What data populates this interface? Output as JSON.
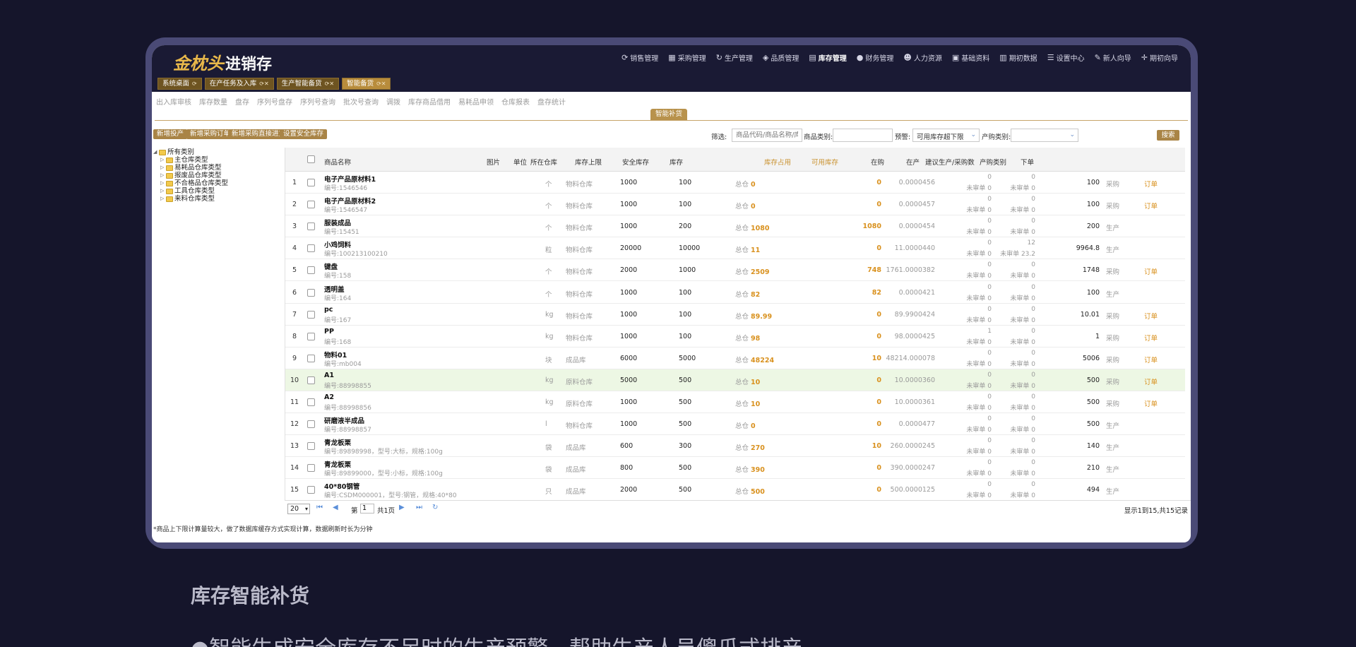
{
  "app": {
    "logo_gold": "金枕头",
    "logo_white": "进销存",
    "nav": [
      {
        "label": "销售管理",
        "icon": "refresh-icon",
        "glyph": "⟳"
      },
      {
        "label": "采购管理",
        "icon": "document-icon",
        "glyph": "▦"
      },
      {
        "label": "生产管理",
        "icon": "cycle-icon",
        "glyph": "↻"
      },
      {
        "label": "品质管理",
        "icon": "diamond-icon",
        "glyph": "◈"
      },
      {
        "label": "库存管理",
        "icon": "grid-icon",
        "glyph": "▤"
      },
      {
        "label": "财务管理",
        "icon": "coin-icon",
        "glyph": "●"
      },
      {
        "label": "人力资源",
        "icon": "people-icon",
        "glyph": "☻"
      },
      {
        "label": "基础资料",
        "icon": "list-icon",
        "glyph": "▣"
      },
      {
        "label": "期初数据",
        "icon": "table-icon",
        "glyph": "▥"
      },
      {
        "label": "设置中心",
        "icon": "sliders-icon",
        "glyph": "☰"
      },
      {
        "label": "新人向导",
        "icon": "guide-icon",
        "glyph": "✎"
      },
      {
        "label": "期初向导",
        "icon": "move-icon",
        "glyph": "✛"
      }
    ],
    "tabs": [
      "系统桌面",
      "在产任务及入库",
      "生产智能备货",
      "智能备货"
    ]
  },
  "subnav": [
    "出入库审核",
    "库存数量",
    "盘存",
    "序列号盘存",
    "序列号查询",
    "批次号查询",
    "调拨",
    "库存商品借用",
    "易耗品申领",
    "仓库报表",
    "盘存统计"
  ],
  "module_tab": "智能补货",
  "actions": [
    "新增投产",
    "新增采购订单",
    "新增采购直接进货",
    "设置安全库存"
  ],
  "filters": {
    "label": "筛选:",
    "search_placeholder": "商品代码/商品名称/库位",
    "category_label": "商品类别:",
    "category_value": "",
    "warning_label": "预警:",
    "warning_value": "可用库存超下限",
    "type_label": "产购类别:",
    "type_value": "",
    "search_button": "搜索"
  },
  "tree": {
    "root": "所有类别",
    "children": [
      "主仓库类型",
      "易耗品仓库类型",
      "报废品仓库类型",
      "不合格品仓库类型",
      "工具仓库类型",
      "来料仓库类型"
    ]
  },
  "table": {
    "headers": {
      "name": "商品名称",
      "image": "图片",
      "unit": "单位",
      "warehouse": "所在仓库",
      "max": "库存上限",
      "safe": "安全库存",
      "stock": "库存",
      "occupied": "库存占用",
      "available": "可用库存",
      "purchasing": "在购",
      "producing": "在产",
      "suggest": "建议生产/采购数",
      "type": "产购类别",
      "order": "下单"
    },
    "rows": [
      {
        "idx": "1",
        "name": "电子产品原材料1",
        "code": "编号:1546546",
        "unit": "个",
        "wh": "物料仓库",
        "max": "1000",
        "safe": "100",
        "stock_pre": "总仓",
        "stock": "0",
        "occ": "0",
        "avail": "0.0000456",
        "po1": "0",
        "po2": "未审单 0",
        "pr1": "0",
        "pr2": "未审单 0",
        "sug": "100",
        "type": "采购",
        "order": "订单"
      },
      {
        "idx": "2",
        "name": "电子产品原材料2",
        "code": "编号:1546547",
        "unit": "个",
        "wh": "物料仓库",
        "max": "1000",
        "safe": "100",
        "stock_pre": "总仓",
        "stock": "0",
        "occ": "0",
        "avail": "0.0000457",
        "po1": "0",
        "po2": "未审单 0",
        "pr1": "0",
        "pr2": "未审单 0",
        "sug": "100",
        "type": "采购",
        "order": "订单"
      },
      {
        "idx": "3",
        "name": "服装成品",
        "code": "编号:15451",
        "unit": "个",
        "wh": "物料仓库",
        "max": "1000",
        "safe": "200",
        "stock_pre": "总仓",
        "stock": "1080",
        "occ": "1080",
        "avail": "0.0000454",
        "po1": "0",
        "po2": "未审单 0",
        "pr1": "0",
        "pr2": "未审单 0",
        "sug": "200",
        "type": "生产",
        "order": ""
      },
      {
        "idx": "4",
        "name": "小鸡饲料",
        "code": "编号:100213100210",
        "unit": "粒",
        "wh": "物料仓库",
        "max": "20000",
        "safe": "10000",
        "stock_pre": "总仓",
        "stock": "11",
        "occ": "0",
        "avail": "11.0000440",
        "po1": "0",
        "po2": "未审单 0",
        "pr1": "12",
        "pr2": "未审单 23.2",
        "sug": "9964.8",
        "type": "生产",
        "order": ""
      },
      {
        "idx": "5",
        "name": "键盘",
        "code": "编号:158",
        "unit": "个",
        "wh": "物料仓库",
        "max": "2000",
        "safe": "1000",
        "stock_pre": "总仓",
        "stock": "2509",
        "occ": "748",
        "avail": "1761.0000382",
        "po1": "0",
        "po2": "未审单 0",
        "pr1": "0",
        "pr2": "未审单 0",
        "sug": "1748",
        "type": "采购",
        "order": "订单"
      },
      {
        "idx": "6",
        "name": "透明盖",
        "code": "编号:164",
        "unit": "个",
        "wh": "物料仓库",
        "max": "1000",
        "safe": "100",
        "stock_pre": "总仓",
        "stock": "82",
        "occ": "82",
        "avail": "0.0000421",
        "po1": "0",
        "po2": "未审单 0",
        "pr1": "0",
        "pr2": "未审单 0",
        "sug": "100",
        "type": "生产",
        "order": ""
      },
      {
        "idx": "7",
        "name": "pc",
        "code": "编号:167",
        "unit": "kg",
        "wh": "物料仓库",
        "max": "1000",
        "safe": "100",
        "stock_pre": "总仓",
        "stock": "89.99",
        "occ": "0",
        "avail": "89.9900424",
        "po1": "0",
        "po2": "未审单 0",
        "pr1": "0",
        "pr2": "未审单 0",
        "sug": "10.01",
        "type": "采购",
        "order": "订单"
      },
      {
        "idx": "8",
        "name": "PP",
        "code": "编号:168",
        "unit": "kg",
        "wh": "物料仓库",
        "max": "1000",
        "safe": "100",
        "stock_pre": "总仓",
        "stock": "98",
        "occ": "0",
        "avail": "98.0000425",
        "po1": "1",
        "po2": "未审单 0",
        "pr1": "0",
        "pr2": "未审单 0",
        "sug": "1",
        "type": "采购",
        "order": "订单"
      },
      {
        "idx": "9",
        "name": "物料01",
        "code": "编号:mb004",
        "unit": "块",
        "wh": "成品库",
        "max": "6000",
        "safe": "5000",
        "stock_pre": "总仓",
        "stock": "48224",
        "occ": "10",
        "avail": "48214.000078",
        "po1": "0",
        "po2": "未审单 0",
        "pr1": "0",
        "pr2": "未审单 0",
        "sug": "5006",
        "type": "采购",
        "order": "订单"
      },
      {
        "idx": "10",
        "name": "A1",
        "code": "编号:88998855",
        "unit": "kg",
        "wh": "原料仓库",
        "max": "5000",
        "safe": "500",
        "stock_pre": "总仓",
        "stock": "10",
        "occ": "0",
        "avail": "10.0000360",
        "po1": "0",
        "po2": "未审单 0",
        "pr1": "0",
        "pr2": "未审单 0",
        "sug": "500",
        "type": "采购",
        "order": "订单"
      },
      {
        "idx": "11",
        "name": "A2",
        "code": "编号:88998856",
        "unit": "kg",
        "wh": "原料仓库",
        "max": "1000",
        "safe": "500",
        "stock_pre": "总仓",
        "stock": "10",
        "occ": "0",
        "avail": "10.0000361",
        "po1": "0",
        "po2": "未审单 0",
        "pr1": "0",
        "pr2": "未审单 0",
        "sug": "500",
        "type": "采购",
        "order": "订单"
      },
      {
        "idx": "12",
        "name": "研磨液半成品",
        "code": "编号:88998857",
        "unit": "l",
        "wh": "物料仓库",
        "max": "1000",
        "safe": "500",
        "stock_pre": "总仓",
        "stock": "0",
        "occ": "0",
        "avail": "0.0000477",
        "po1": "0",
        "po2": "未审单 0",
        "pr1": "0",
        "pr2": "未审单 0",
        "sug": "500",
        "type": "生产",
        "order": ""
      },
      {
        "idx": "13",
        "name": "青龙板栗",
        "code": "编号:89898998，型号:大标，规格:100g",
        "unit": "袋",
        "wh": "成品库",
        "max": "600",
        "safe": "300",
        "stock_pre": "总仓",
        "stock": "270",
        "occ": "10",
        "avail": "260.0000245",
        "po1": "0",
        "po2": "未审单 0",
        "pr1": "0",
        "pr2": "未审单 0",
        "sug": "140",
        "type": "生产",
        "order": ""
      },
      {
        "idx": "14",
        "name": "青龙板栗",
        "code": "编号:89899000，型号:小标，规格:100g",
        "unit": "袋",
        "wh": "成品库",
        "max": "800",
        "safe": "500",
        "stock_pre": "总仓",
        "stock": "390",
        "occ": "0",
        "avail": "390.0000247",
        "po1": "0",
        "po2": "未审单 0",
        "pr1": "0",
        "pr2": "未审单 0",
        "sug": "210",
        "type": "生产",
        "order": ""
      },
      {
        "idx": "15",
        "name": "40*80钢管",
        "code": "编号:CSDM000001，型号:钢管，规格:40*80",
        "unit": "只",
        "wh": "成品库",
        "max": "2000",
        "safe": "500",
        "stock_pre": "总仓",
        "stock": "500",
        "occ": "0",
        "avail": "500.0000125",
        "po1": "0",
        "po2": "未审单 0",
        "pr1": "0",
        "pr2": "未审单 0",
        "sug": "494",
        "type": "生产",
        "order": ""
      }
    ]
  },
  "pager": {
    "page_size": "20",
    "page_prefix": "第",
    "page_value": "1",
    "page_suffix": "共1页",
    "info": "显示1到15,共15记录"
  },
  "note": "*商品上下限计算量较大，做了数据库缓存方式实现计算，数据刷新时长为分钟",
  "promo": {
    "heading": "库存智能补货",
    "bullet": "●智能生成安全库存不足时的生产预警，帮助生产人员傻瓜式排产"
  },
  "colors": {
    "accent": "#b8924c",
    "order_link": "#d9911e",
    "highlight_row": "#edf7e4",
    "dark_bg": "#15152b"
  }
}
